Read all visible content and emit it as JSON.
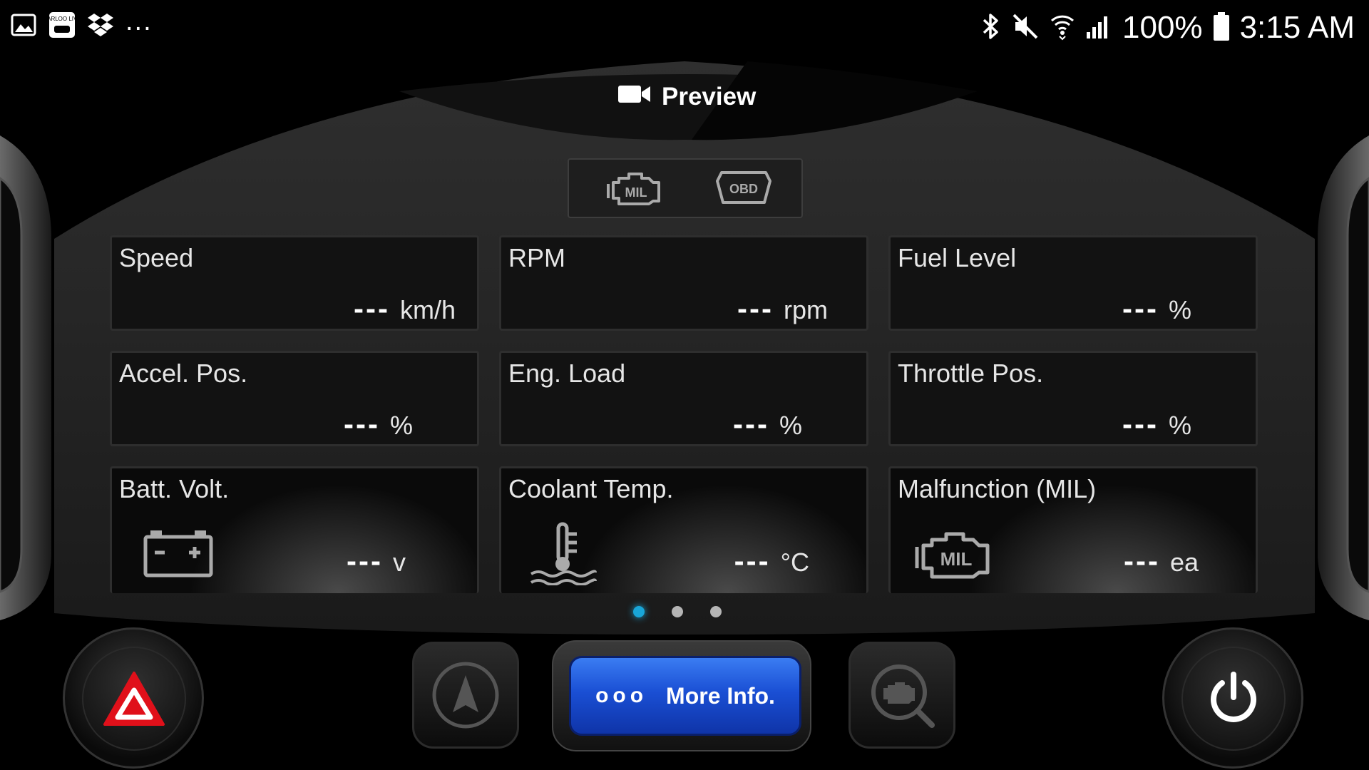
{
  "status_bar": {
    "left_icons": [
      "gallery-icon",
      "carloo-live-icon",
      "dropbox-icon"
    ],
    "overflow": "...",
    "carloo_text": "CARLOO LIVE",
    "battery": "100%",
    "time": "3:15 AM"
  },
  "dashboard": {
    "preview_label": "Preview",
    "modes": [
      {
        "name": "mil-mode",
        "label": "MIL"
      },
      {
        "name": "obd-mode",
        "label": "OBD"
      }
    ],
    "tiles": [
      {
        "label": "Speed",
        "value": "---",
        "unit": "km/h"
      },
      {
        "label": "RPM",
        "value": "---",
        "unit": "rpm"
      },
      {
        "label": "Fuel Level",
        "value": "---",
        "unit": "%"
      },
      {
        "label": "Accel. Pos.",
        "value": "---",
        "unit": "%"
      },
      {
        "label": "Eng. Load",
        "value": "---",
        "unit": "%"
      },
      {
        "label": "Throttle Pos.",
        "value": "---",
        "unit": "%"
      },
      {
        "label": "Batt. Volt.",
        "value": "---",
        "unit": "v",
        "icon": "battery-icon"
      },
      {
        "label": "Coolant Temp.",
        "value": "---",
        "unit": "°C",
        "icon": "coolant-temp-icon"
      },
      {
        "label": "Malfunction (MIL)",
        "value": "---",
        "unit": "ea",
        "icon": "engine-mil-icon",
        "icon_text": "MIL"
      }
    ],
    "pager": {
      "pages": 3,
      "current": 1
    }
  },
  "bottom_bar": {
    "more_info_label": "More Info.",
    "more_info_dots": "ooo"
  },
  "colors": {
    "accent_blue": "#1a4fd4",
    "pager_active": "#19a6d8",
    "hazard_red": "#e0101a"
  }
}
